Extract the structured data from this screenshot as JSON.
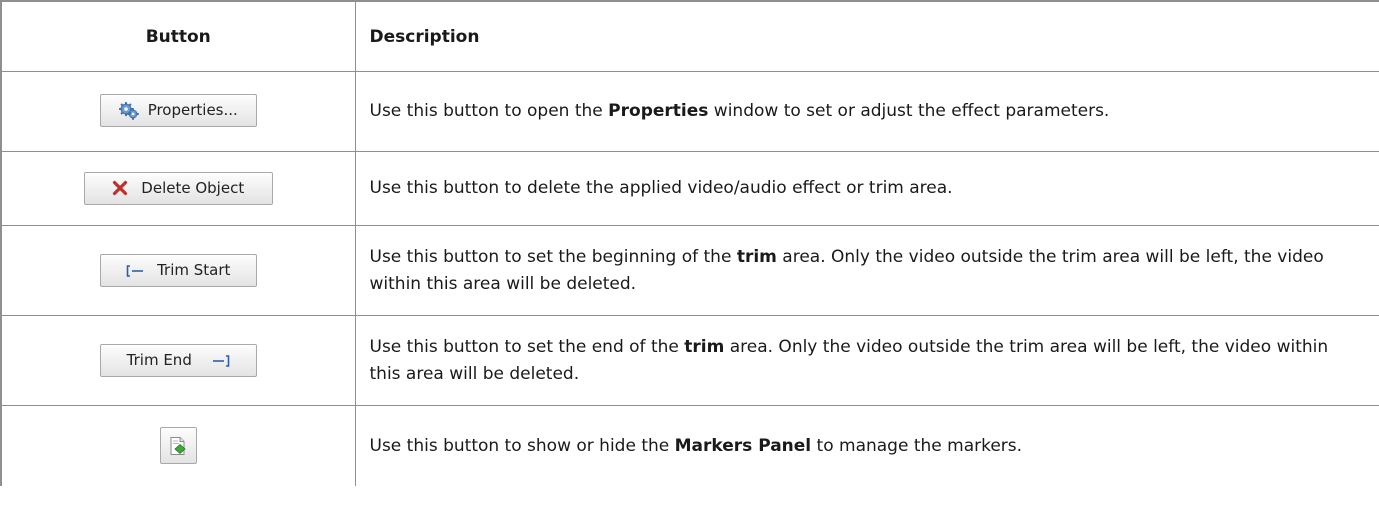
{
  "table": {
    "headers": {
      "button": "Button",
      "description": "Description"
    },
    "rows": [
      {
        "button_label": "Properties...",
        "button_icon": "gears-icon",
        "desc_before": "Use this button to open the ",
        "desc_bold": "Properties",
        "desc_after": " window to set or adjust the effect parameters."
      },
      {
        "button_label": "Delete Object",
        "button_icon": "red-x-icon",
        "desc": "Use this button to delete the applied video/audio effect or trim area."
      },
      {
        "button_label": "Trim Start",
        "button_icon": "trim-start-icon",
        "desc_before": "Use this button to set the beginning of the ",
        "desc_bold": "trim",
        "desc_after": " area. Only the video outside the trim area will be left, the video within this area will be deleted."
      },
      {
        "button_label": "Trim End",
        "button_icon": "trim-end-icon",
        "desc_before": "Use this button to set the end of the ",
        "desc_bold": "trim",
        "desc_after": " area. Only the video outside the trim area will be left, the video within this area will be deleted."
      },
      {
        "button_label": "",
        "button_icon": "markers-panel-icon",
        "desc_before": "Use this button to show or hide the ",
        "desc_bold": "Markers Panel",
        "desc_after": " to manage the markers."
      }
    ]
  },
  "colors": {
    "border": "#8f8f8f",
    "delete_x": "#c0302b",
    "marker_green": "#3fa83a",
    "trim_blue": "#2f5ea8",
    "gear_blue": "#6b9ad0"
  }
}
